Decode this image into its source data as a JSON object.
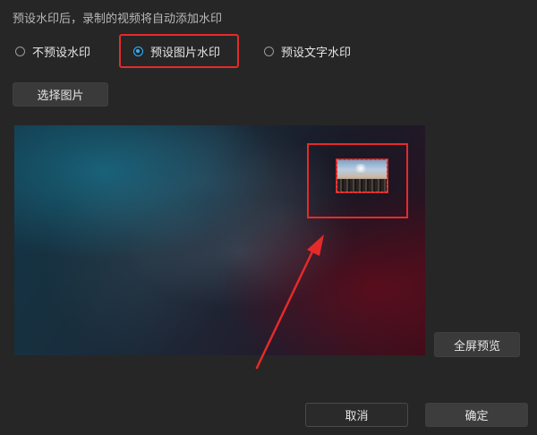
{
  "hint": "预设水印后，录制的视频将自动添加水印",
  "watermark_options": [
    {
      "label": "不预设水印",
      "checked": false
    },
    {
      "label": "预设图片水印",
      "checked": true
    },
    {
      "label": "预设文字水印",
      "checked": false
    }
  ],
  "buttons": {
    "choose_image": "选择图片",
    "fullscreen_preview": "全屏预览",
    "cancel": "取消",
    "ok": "确定"
  },
  "colors": {
    "accent_radio": "#2fb3ff",
    "annotation_red": "#e52a2a",
    "background": "#262626"
  }
}
